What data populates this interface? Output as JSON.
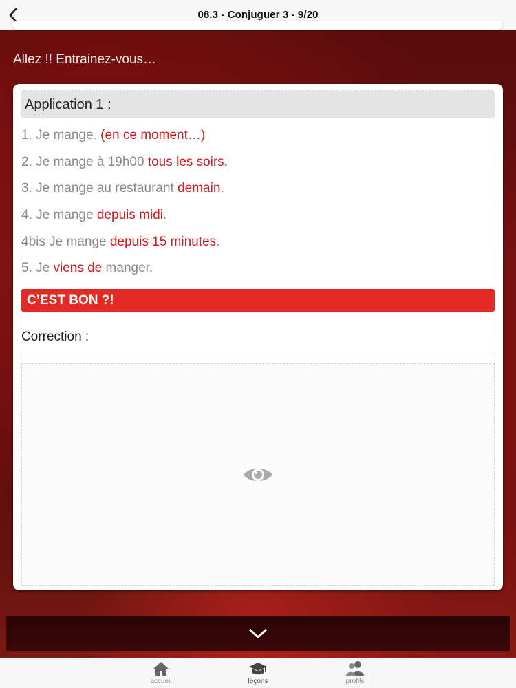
{
  "header": {
    "title": "08.3 - Conjuguer 3 - 9/20",
    "back_icon": "chevron-left-icon"
  },
  "intro": "Allez !! Entrainez-vous…",
  "exercise": {
    "title": "Application 1 :",
    "lines": [
      [
        {
          "text": "1. Je mange. ",
          "red": false
        },
        {
          "text": "(en ce moment…)",
          "red": true
        }
      ],
      [
        {
          "text": "2. Je mange à 19h00 ",
          "red": false
        },
        {
          "text": "tous les soirs.",
          "red": true
        }
      ],
      [
        {
          "text": "3. Je mange au restaurant ",
          "red": false
        },
        {
          "text": "demain",
          "red": true
        },
        {
          "text": ".",
          "red": false
        }
      ],
      [
        {
          "text": "4. Je mange ",
          "red": false
        },
        {
          "text": "depuis midi",
          "red": true
        },
        {
          "text": ".",
          "red": false
        }
      ],
      [
        {
          "text": "4bis Je mange ",
          "red": false
        },
        {
          "text": "depuis 15 minutes",
          "red": true
        },
        {
          "text": ".",
          "red": false
        }
      ],
      [
        {
          "text": "5. Je ",
          "red": false
        },
        {
          "text": "viens de",
          "red": true
        },
        {
          "text": " manger.",
          "red": false
        }
      ]
    ],
    "check_button": "C’EST BON ?!",
    "correction_label": "Correction :",
    "reveal_icon": "eye-icon"
  },
  "bottom": {
    "expand_icon": "chevron-down-icon"
  },
  "tabs": [
    {
      "label": "accueil",
      "icon": "home-icon",
      "active": false
    },
    {
      "label": "leçons",
      "icon": "graduation-cap-icon",
      "active": true
    },
    {
      "label": "profils",
      "icon": "users-icon",
      "active": false
    }
  ],
  "colors": {
    "accent_red": "#e32a24",
    "text_red": "#d4191c",
    "text_gray": "#8a8a8a"
  }
}
